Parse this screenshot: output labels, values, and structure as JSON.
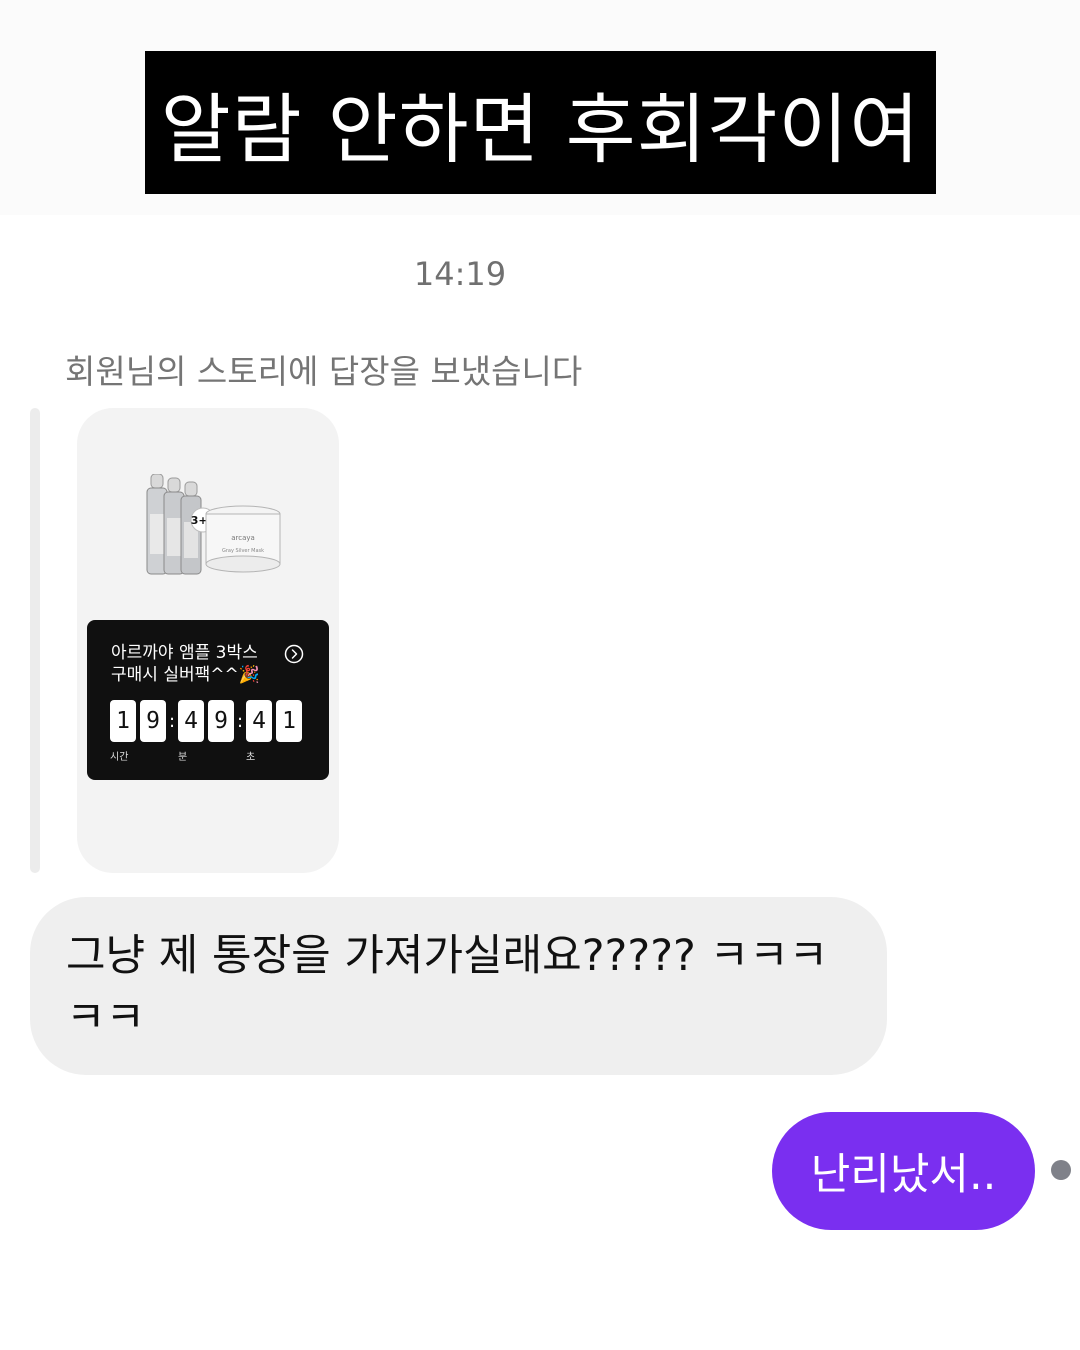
{
  "caption": "알람 안하면 후회각이여",
  "chat": {
    "timestamp": "14:19",
    "story_reply_note": "회원님의 스토리에 답장을 보냈습니다",
    "story": {
      "promo_line1": "아르까야 앰플 3박스",
      "promo_line2": "구매시 실버팩^^🎉",
      "product_badge": "3+1",
      "jar_brand": "arcaya",
      "jar_label": "Gray Silver Mask",
      "countdown": {
        "digits": [
          "1",
          "9",
          "4",
          "9",
          "4",
          "1"
        ],
        "separator": ":",
        "unit_hours": "시간",
        "unit_minutes": "분",
        "unit_seconds": "초"
      },
      "arrow_icon": "chevron-right-circle-icon"
    },
    "messages": [
      {
        "direction": "incoming",
        "text": "그냥 제 통장을 가져가실래요????? ㅋㅋㅋㅋㅋ"
      },
      {
        "direction": "outgoing",
        "text": "난리났서.."
      }
    ]
  },
  "colors": {
    "caption_bg": "#000000",
    "incoming_bubble": "#efefef",
    "outgoing_bubble": "#7a2ff0",
    "promo_bg": "#101010"
  }
}
